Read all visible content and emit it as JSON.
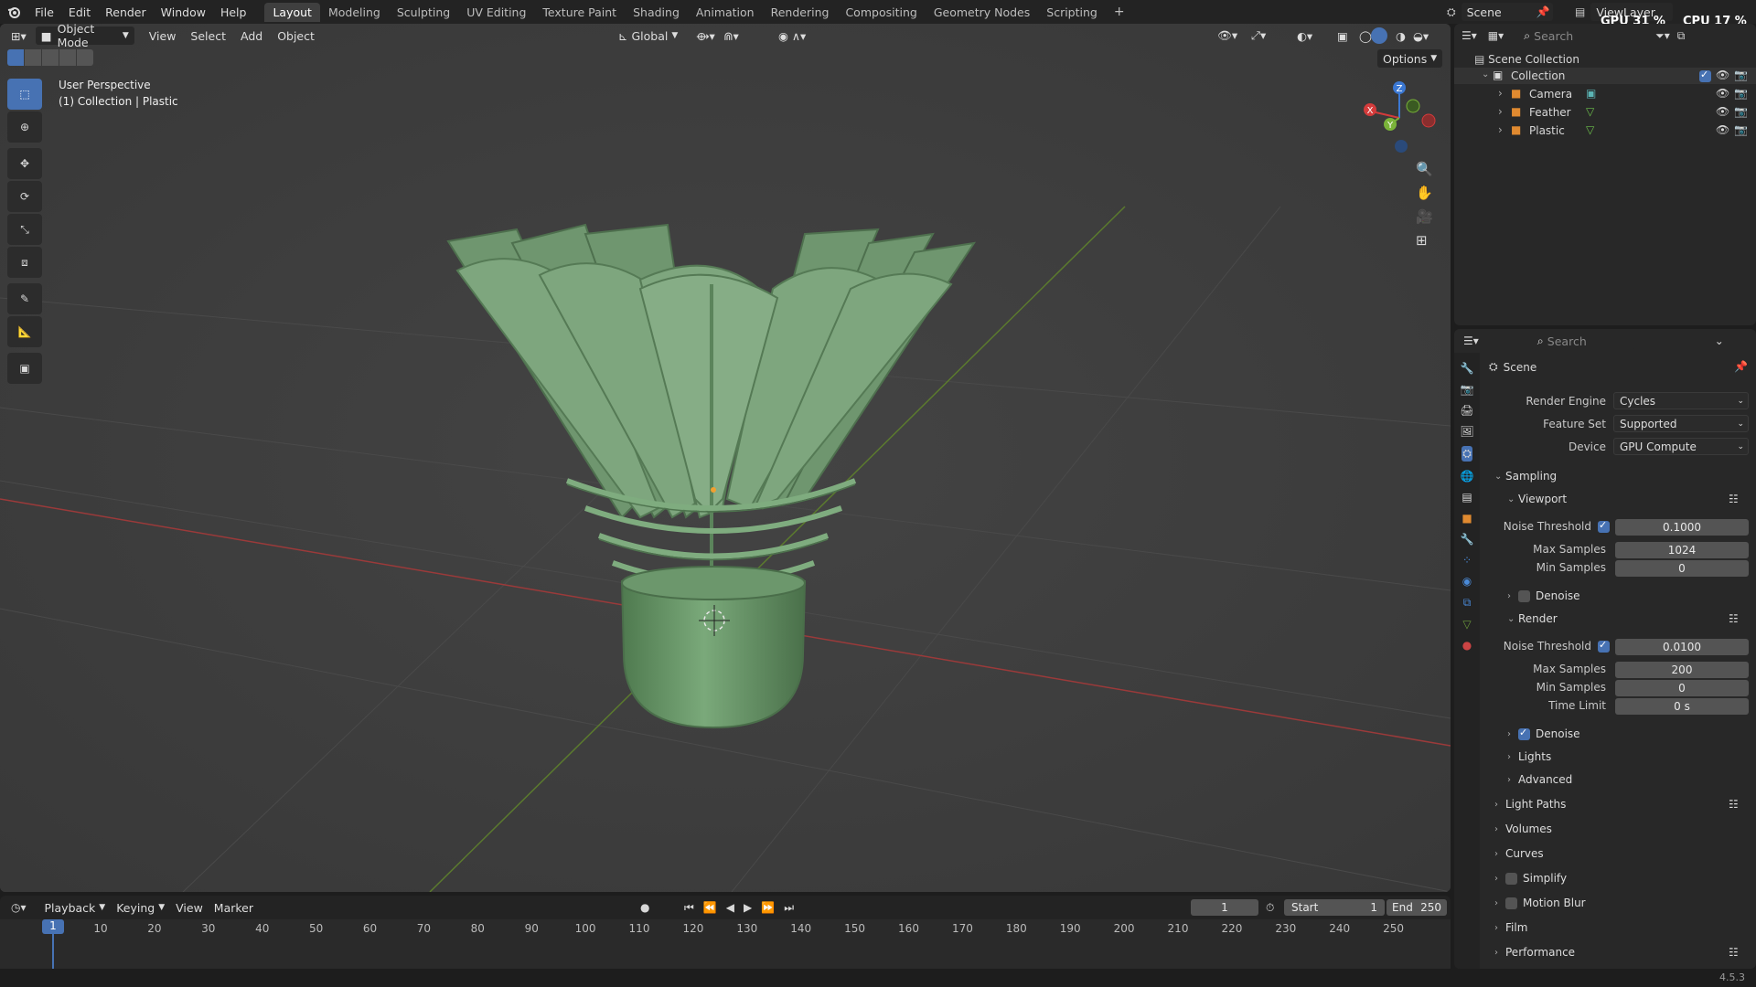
{
  "topbar": {
    "menus": [
      "File",
      "Edit",
      "Render",
      "Window",
      "Help"
    ],
    "workspaces": [
      "Layout",
      "Modeling",
      "Sculpting",
      "UV Editing",
      "Texture Paint",
      "Shading",
      "Animation",
      "Rendering",
      "Compositing",
      "Geometry Nodes",
      "Scripting"
    ],
    "active_workspace": "Layout",
    "scene_name": "Scene",
    "view_layer": "ViewLayer",
    "gpu": "GPU 31 %",
    "cpu": "CPU 17 %"
  },
  "viewport": {
    "mode": "Object Mode",
    "menus": [
      "View",
      "Select",
      "Add",
      "Object"
    ],
    "transform_orientation": "Global",
    "options_label": "Options",
    "overlay_title": "User Perspective",
    "overlay_subtitle": "(1) Collection | Plastic",
    "gizmo_axes": {
      "x": "X",
      "y": "Y",
      "z": "Z"
    }
  },
  "outliner": {
    "search_placeholder": "Search",
    "root": "Scene Collection",
    "collection": "Collection",
    "items": [
      {
        "name": "Camera",
        "icon": "camera-icon"
      },
      {
        "name": "Feather",
        "icon": "mesh-icon"
      },
      {
        "name": "Plastic",
        "icon": "mesh-icon"
      }
    ]
  },
  "properties": {
    "search_placeholder": "Search",
    "context_title": "Scene",
    "render_engine_label": "Render Engine",
    "render_engine": "Cycles",
    "feature_set_label": "Feature Set",
    "feature_set": "Supported",
    "device_label": "Device",
    "device": "GPU Compute",
    "sampling": "Sampling",
    "viewport": {
      "title": "Viewport",
      "noise_threshold_label": "Noise Threshold",
      "noise_threshold": "0.1000",
      "max_samples_label": "Max Samples",
      "max_samples": "1024",
      "min_samples_label": "Min Samples",
      "min_samples": "0",
      "denoise": "Denoise"
    },
    "render": {
      "title": "Render",
      "noise_threshold_label": "Noise Threshold",
      "noise_threshold": "0.0100",
      "max_samples_label": "Max Samples",
      "max_samples": "200",
      "min_samples_label": "Min Samples",
      "min_samples": "0",
      "time_limit_label": "Time Limit",
      "time_limit": "0 s",
      "denoise": "Denoise"
    },
    "subsections": [
      "Lights",
      "Advanced"
    ],
    "panels": [
      "Light Paths",
      "Volumes",
      "Curves",
      "Simplify",
      "Motion Blur",
      "Film",
      "Performance"
    ]
  },
  "timeline": {
    "menus": [
      "Playback",
      "Keying",
      "View",
      "Marker"
    ],
    "current_frame": "1",
    "start_label": "Start",
    "start": "1",
    "end_label": "End",
    "end": "250",
    "ticks": [
      "10",
      "20",
      "30",
      "40",
      "50",
      "60",
      "70",
      "80",
      "90",
      "100",
      "110",
      "120",
      "130",
      "140",
      "150",
      "160",
      "170",
      "180",
      "190",
      "200",
      "210",
      "220",
      "230",
      "240",
      "250"
    ],
    "playhead": "1"
  },
  "statusbar": {
    "version": "4.5.3"
  },
  "colors": {
    "accent": "#4772b3",
    "model": "#6b9a6b",
    "x_axis": "#d33b3b",
    "y_axis": "#7ab339",
    "z_axis": "#3b78d3"
  }
}
